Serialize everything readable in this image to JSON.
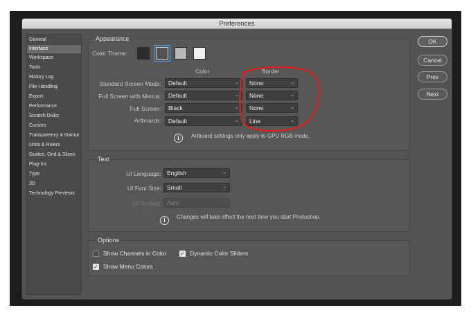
{
  "window": {
    "title": "Preferences"
  },
  "sidebar": {
    "items": [
      {
        "label": "General",
        "selected": false
      },
      {
        "label": "Interface",
        "selected": true
      },
      {
        "label": "Workspace",
        "selected": false
      },
      {
        "label": "Tools",
        "selected": false
      },
      {
        "label": "History Log",
        "selected": false
      },
      {
        "label": "File Handling",
        "selected": false
      },
      {
        "label": "Export",
        "selected": false
      },
      {
        "label": "Performance",
        "selected": false
      },
      {
        "label": "Scratch Disks",
        "selected": false
      },
      {
        "label": "Cursors",
        "selected": false
      },
      {
        "label": "Transparency & Gamut",
        "selected": false
      },
      {
        "label": "Units & Rulers",
        "selected": false
      },
      {
        "label": "Guides, Grid & Slices",
        "selected": false
      },
      {
        "label": "Plug-Ins",
        "selected": false
      },
      {
        "label": "Type",
        "selected": false
      },
      {
        "label": "3D",
        "selected": false
      },
      {
        "label": "Technology Previews",
        "selected": false
      }
    ]
  },
  "appearance": {
    "title": "Appearance",
    "color_theme_label": "Color Theme:",
    "themes": [
      {
        "name": "darkest",
        "color": "#2b2b2b",
        "selected": false
      },
      {
        "name": "dark",
        "color": "#535353",
        "selected": true
      },
      {
        "name": "medium",
        "color": "#b8b8b8",
        "selected": false
      },
      {
        "name": "light",
        "color": "#f0f0f0",
        "selected": false
      }
    ],
    "col_color": "Color",
    "col_border": "Border",
    "rows": [
      {
        "label": "Standard Screen Mode:",
        "color": "Default",
        "border": "None"
      },
      {
        "label": "Full Screen with Menus:",
        "color": "Default",
        "border": "None"
      },
      {
        "label": "Full Screen:",
        "color": "Black",
        "border": "None"
      },
      {
        "label": "Artboards:",
        "color": "Default",
        "border": "Line"
      }
    ],
    "note": "Artboard settings only apply to GPU RGB mode."
  },
  "text_group": {
    "title": "Text",
    "ui_language_label": "UI Language:",
    "ui_language_value": "English",
    "ui_font_size_label": "UI Font Size:",
    "ui_font_size_value": "Small",
    "ui_scaling_label": "UI Scaling:",
    "ui_scaling_value": "Auto",
    "note": "Changes will take effect the next time you start Photoshop."
  },
  "options": {
    "title": "Options",
    "show_channels_in_color": {
      "label": "Show Channels in Color",
      "checked": false
    },
    "dynamic_color_sliders": {
      "label": "Dynamic Color Sliders",
      "checked": true
    },
    "show_menu_colors": {
      "label": "Show Menu Colors",
      "checked": true
    }
  },
  "buttons": {
    "ok": "OK",
    "cancel": "Cancel",
    "prev": "Prev",
    "next": "Next"
  },
  "icons": {
    "info": "info-icon",
    "chevron": "chevron-down-icon",
    "check": "checkmark-icon"
  },
  "colors": {
    "accent": "#4aa3ff",
    "annotation": "#e0201c",
    "panel": "#535353"
  }
}
